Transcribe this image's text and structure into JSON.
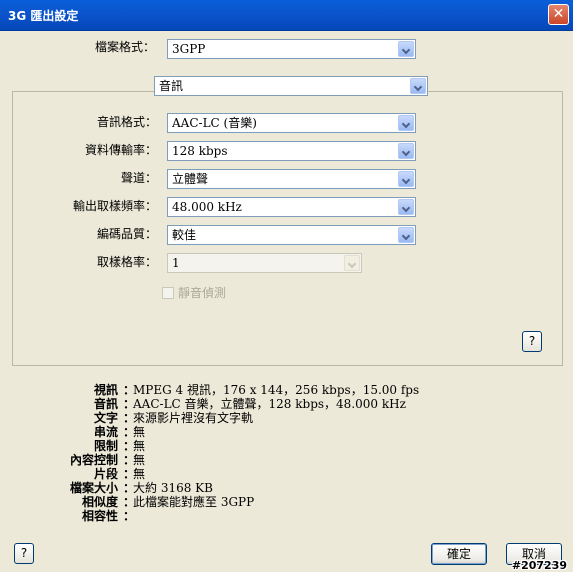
{
  "window": {
    "title": "3G 匯出設定",
    "close_glyph": "✕"
  },
  "format": {
    "label": "檔案格式：",
    "value": "3GPP"
  },
  "section": {
    "value": "音訊"
  },
  "audio": {
    "fields": [
      {
        "label": "音訊格式：",
        "value": "AAC-LC (音樂)"
      },
      {
        "label": "資料傳輸率：",
        "value": "128 kbps"
      },
      {
        "label": "聲道：",
        "value": "立體聲"
      },
      {
        "label": "輸出取樣頻率：",
        "value": "48.000 kHz"
      },
      {
        "label": "編碼品質：",
        "value": "較佳"
      }
    ],
    "sample_rate": {
      "label": "取樣格率：",
      "value": "1"
    },
    "silence_detect": {
      "label": "靜音偵測",
      "checked": false
    }
  },
  "help_glyph": "?",
  "summary": [
    {
      "key": "視訊",
      "value": "MPEG 4 視訊，176 x 144，256 kbps，15.00 fps"
    },
    {
      "key": "音訊",
      "value": "AAC-LC 音樂，立體聲，128 kbps，48.000 kHz"
    },
    {
      "key": "文字",
      "value": "來源影片裡沒有文字軌"
    },
    {
      "key": "串流",
      "value": "無"
    },
    {
      "key": "限制",
      "value": "無"
    },
    {
      "key": "內容控制",
      "value": "無"
    },
    {
      "key": "片段",
      "value": "無"
    },
    {
      "key": "檔案大小",
      "value": "大約 3168 KB"
    },
    {
      "key": "相似度",
      "value": "此檔案能對應至 3GPP"
    },
    {
      "key": "相容性",
      "value": ""
    }
  ],
  "summary_colon": "：",
  "buttons": {
    "ok": "確定",
    "cancel": "取消"
  },
  "watermark": "#207239"
}
